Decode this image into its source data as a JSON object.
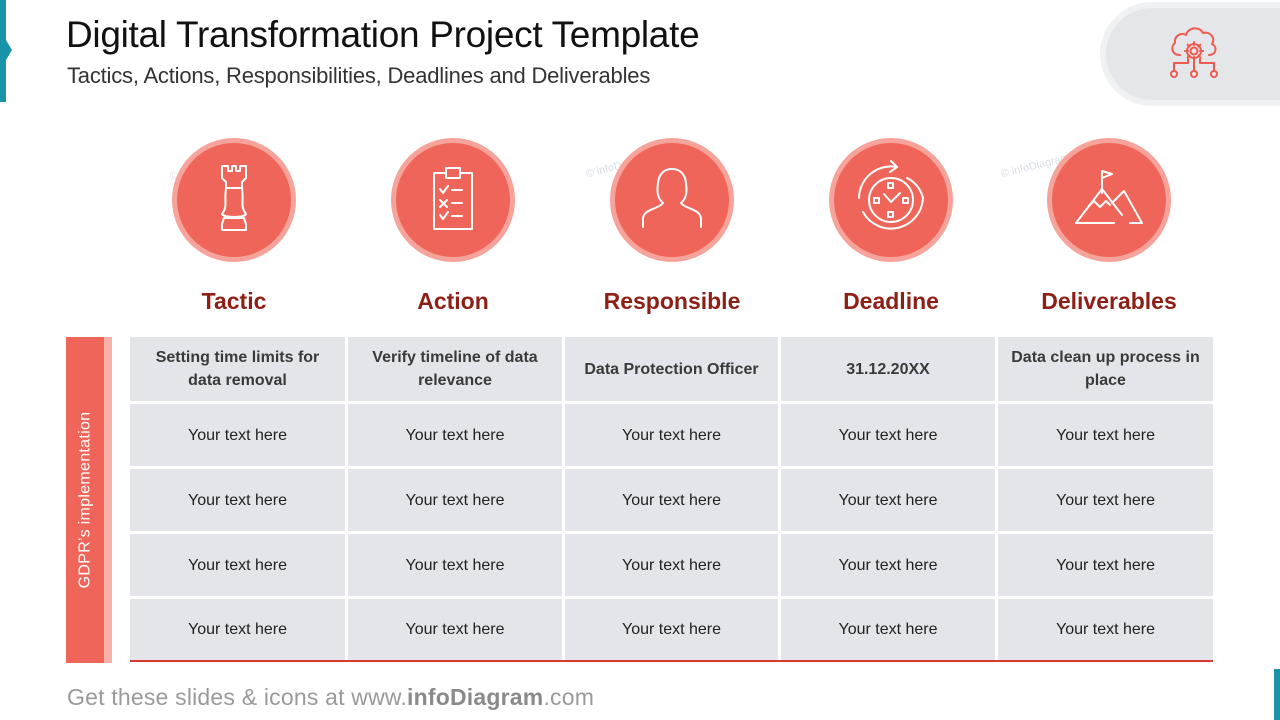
{
  "header": {
    "title": "Digital Transformation Project Template",
    "subtitle": "Tactics, Actions, Responsibilities, Deadlines and Deliverables",
    "corner_icon": "cloud-gear-network-icon"
  },
  "columns": [
    {
      "label": "Tactic",
      "icon": "chess-rook-icon"
    },
    {
      "label": "Action",
      "icon": "checklist-clipboard-icon"
    },
    {
      "label": "Responsible",
      "icon": "person-icon"
    },
    {
      "label": "Deadline",
      "icon": "clock-refresh-icon"
    },
    {
      "label": "Deliverables",
      "icon": "mountain-flag-icon"
    }
  ],
  "watermark": "© infoDiagram",
  "side_label": "GDPR’s implementation",
  "table": {
    "rows": [
      [
        "Setting time limits for data removal",
        "Verify timeline of data relevance",
        "Data Protection Officer",
        "31.12.20XX",
        "Data clean up process in place"
      ],
      [
        "Your text here",
        "Your text here",
        "Your text here",
        "Your text here",
        "Your text here"
      ],
      [
        "Your text here",
        "Your text here",
        "Your text here",
        "Your text here",
        "Your text here"
      ],
      [
        "Your text here",
        "Your text here",
        "Your text here",
        "Your text here",
        "Your text here"
      ],
      [
        "Your text here",
        "Your text here",
        "Your text here",
        "Your text here",
        "Your text here"
      ]
    ]
  },
  "footer": {
    "prefix": "Get these slides & icons at www.",
    "brand": "infoDiagram",
    "suffix": ".com"
  },
  "colors": {
    "accent_teal": "#1a93a8",
    "circle_fill": "#f0655a",
    "circle_ring": "#f6a39b",
    "label_red": "#8e1f16",
    "cell_bg": "#e3e5ea"
  }
}
